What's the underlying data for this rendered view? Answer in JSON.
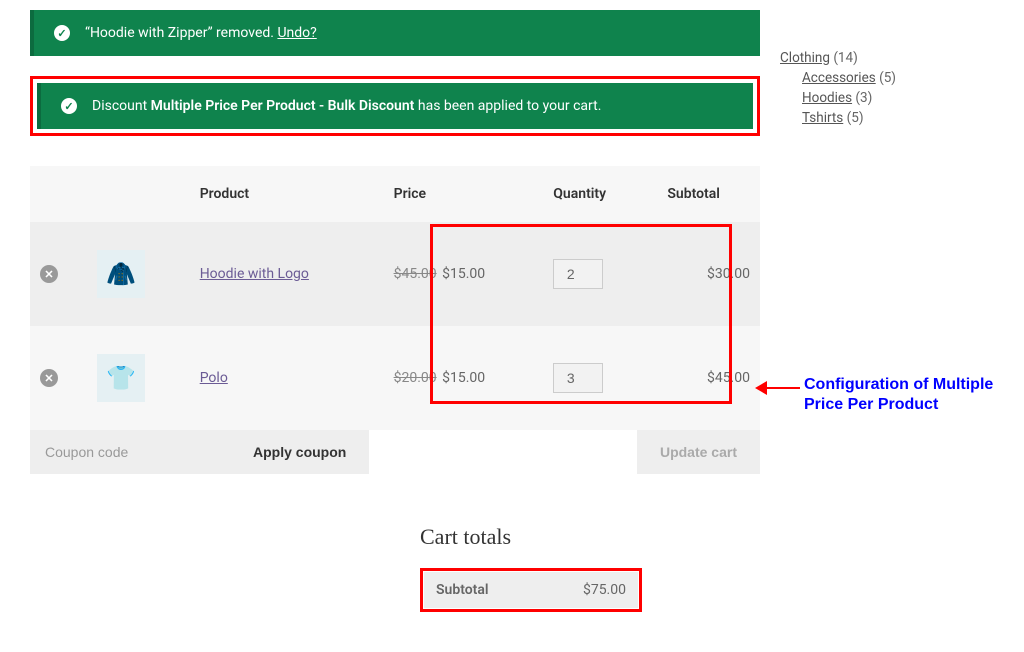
{
  "notices": {
    "removed": {
      "prefix": "“Hoodie with Zipper” removed. ",
      "undo_label": "Undo?"
    },
    "discount": {
      "prefix": "Discount ",
      "name": "Multiple Price Per Product - Bulk Discount",
      "suffix": " has been applied to your cart."
    }
  },
  "cart": {
    "headers": {
      "product": "Product",
      "price": "Price",
      "quantity": "Quantity",
      "subtotal": "Subtotal"
    },
    "items": [
      {
        "name": "Hoodie with Logo",
        "thumb_glyph": "🧥",
        "price_old": "$45.00",
        "price_new": "$15.00",
        "qty": "2",
        "subtotal": "$30.00"
      },
      {
        "name": "Polo",
        "thumb_glyph": "👕",
        "price_old": "$20.00",
        "price_new": "$15.00",
        "qty": "3",
        "subtotal": "$45.00"
      }
    ],
    "coupon_placeholder": "Coupon code",
    "apply_label": "Apply coupon",
    "update_label": "Update cart"
  },
  "totals": {
    "title": "Cart totals",
    "rows": {
      "subtotal_label": "Subtotal",
      "subtotal_value": "$75.00"
    }
  },
  "sidebar": {
    "categories": [
      {
        "name": "Clothing",
        "count": "(14)"
      }
    ],
    "subcategories": [
      {
        "name": "Accessories",
        "count": "(5)"
      },
      {
        "name": "Hoodies",
        "count": "(3)"
      },
      {
        "name": "Tshirts",
        "count": "(5)"
      }
    ]
  },
  "annotation": {
    "text": "Configuration of Multiple Price Per Product"
  }
}
